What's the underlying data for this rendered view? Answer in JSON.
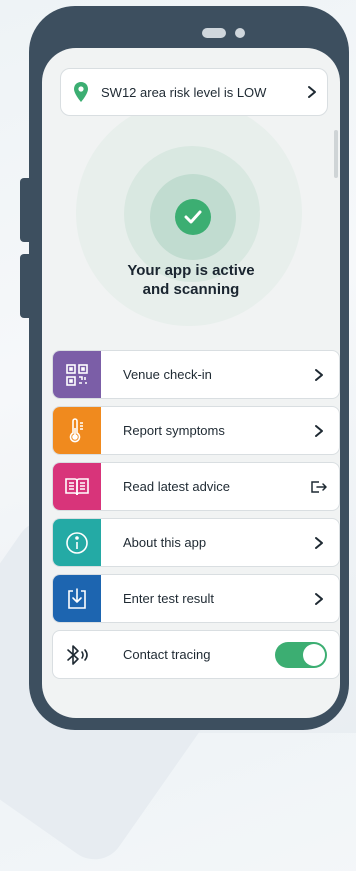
{
  "risk_banner": {
    "text": "SW12 area risk level is LOW"
  },
  "status": {
    "line1": "Your app is active",
    "line2": "and scanning"
  },
  "menu": {
    "items": [
      {
        "label": "Venue check-in",
        "color": "#7b5ea7",
        "icon": "qr-code-icon",
        "action": "chevron"
      },
      {
        "label": "Report symptoms",
        "color": "#f08a1e",
        "icon": "thermometer-icon",
        "action": "chevron"
      },
      {
        "label": "Read latest advice",
        "color": "#d8347a",
        "icon": "book-icon",
        "action": "external-link"
      },
      {
        "label": "About this app",
        "color": "#24aaa5",
        "icon": "info-icon",
        "action": "chevron"
      },
      {
        "label": "Enter test result",
        "color": "#1d65b0",
        "icon": "download-icon",
        "action": "chevron"
      },
      {
        "label": "Contact tracing",
        "color": "#ffffff",
        "icon": "bluetooth-icon",
        "action": "toggle",
        "enabled": true
      }
    ]
  },
  "colors": {
    "accent_green": "#3cae72",
    "phone_frame": "#3d4f5f"
  }
}
